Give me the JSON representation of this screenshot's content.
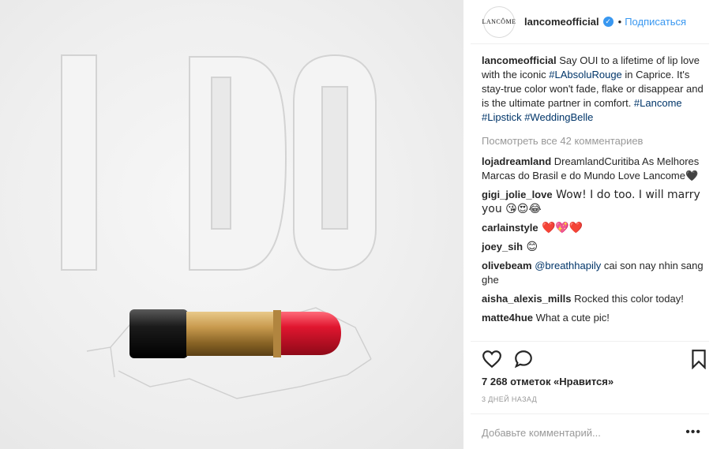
{
  "photo": {
    "lettering": "I DO",
    "subject": "lipstick"
  },
  "header": {
    "avatar_text": "LANCÔME",
    "username": "lancomeofficial",
    "verified_icon": "verified-check-icon",
    "separator": "•",
    "follow_label": "Подписаться"
  },
  "caption": {
    "user": "lancomeofficial",
    "text1": " Say OUI to a lifetime of lip love with the iconic ",
    "tag1": "#LAbsoluRouge",
    "text2": " in Caprice. It's stay-true color won't fade, flake or disappear and is the ultimate partner in comfort. ",
    "tag2": "#Lancome",
    "tag3": "#Lipstick",
    "tag4": "#WeddingBelle"
  },
  "view_all": "Посмотреть все 42 комментариев",
  "comments": [
    {
      "user": "lojadreamland",
      "text": " DreamlandCuritiba As Melhores Marcas do Brasil e do Mundo Love Lancome🖤"
    },
    {
      "user": "gigi_jolie_love",
      "text": " Wow! I do too. I will marry you 😘😍😂"
    },
    {
      "user": "carlainstyle",
      "text": " ❤️💖❤️"
    },
    {
      "user": "joey_sih",
      "text": " 😊"
    },
    {
      "user": "olivebeam",
      "mention": "@breathhapily",
      "text": " cai son nay nhin sang ghe"
    },
    {
      "user": "aisha_alexis_mills",
      "text": " Rocked this color today!"
    },
    {
      "user": "matte4hue",
      "text": " What a cute pic!"
    }
  ],
  "likes": "7 268 отметок «Нравится»",
  "time_ago": "3 ДНЕЙ НАЗАД",
  "add_comment_placeholder": "Добавьте комментарий...",
  "more_label": "•••",
  "colors": {
    "link": "#003569",
    "accent": "#3897f0",
    "lipstick": "#d8152f",
    "gold": "#c89a4e"
  }
}
